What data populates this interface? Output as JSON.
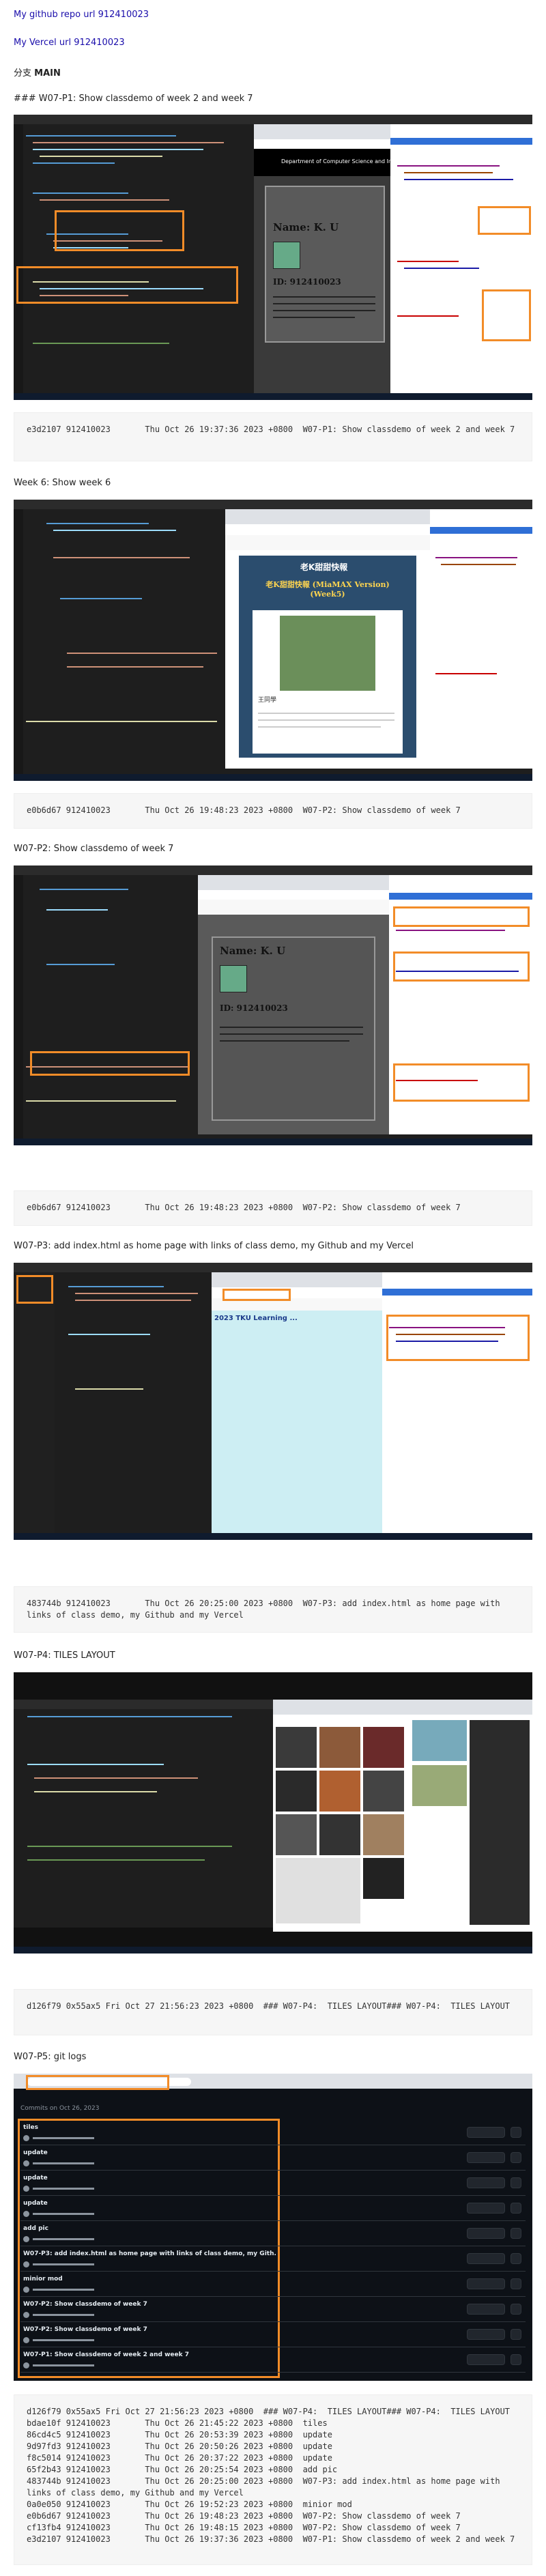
{
  "links": {
    "github_repo": "My github repo url 912410023",
    "vercel": "My Vercel url 912410023"
  },
  "branch": {
    "prefix": "分支",
    "name": "MAIN"
  },
  "sections": [
    {
      "title": "### W07-P1: Show classdemo of week 2 and week 7",
      "commit": "e3d2107 912410023       Thu Oct 26 19:37:36 2023 +0800  W07-P1: Show classdemo of week 2 and week 7",
      "screenshot": {
        "site_header": "Department of Computer Science and Information Engineering",
        "name_label": "Name: K. U",
        "id_label": "ID: 912410023"
      }
    },
    {
      "title": "Week 6: Show week 6",
      "commit": "e0b6d67 912410023       Thu Oct 26 19:48:23 2023 +0800  W07-P2: Show classdemo of week 7",
      "screenshot": {
        "title_cn": "老K甜甜快報",
        "subtitle": "老K甜甜快報 (MiaMAX Version) (Week5)",
        "author": "王同學"
      }
    },
    {
      "title": "W07-P2: Show classdemo of week 7",
      "commit": "e0b6d67 912410023       Thu Oct 26 19:48:23 2023 +0800  W07-P2: Show classdemo of week 7",
      "screenshot": {
        "name_label": "Name: K. U",
        "id_label": "ID: 912410023"
      }
    },
    {
      "title": "W07-P3: add index.html as home page with links of class demo, my Github and my Vercel",
      "commit": "483744b 912410023       Thu Oct 26 20:25:00 2023 +0800  W07-P3: add index.html as home page with links of class demo, my Github and my Vercel",
      "screenshot": {
        "page_heading": "2023 TKU Learning ..."
      }
    },
    {
      "title": "W07-P4: TILES LAYOUT",
      "commit": "d126f79 0x55ax5 Fri Oct 27 21:56:23 2023 +0800  ### W07-P4:  TILES LAYOUT### W07-P4:  TILES LAYOUT",
      "screenshot": {}
    },
    {
      "title": "W07-P5: git logs",
      "commit": "d126f79 0x55ax5 Fri Oct 27 21:56:23 2023 +0800  ### W07-P4:  TILES LAYOUT### W07-P4:  TILES LAYOUT\nbdae10f 912410023       Thu Oct 26 21:45:22 2023 +0800  tiles\n86cd4c5 912410023       Thu Oct 26 20:53:39 2023 +0800  update\n9d97fd3 912410023       Thu Oct 26 20:50:26 2023 +0800  update\nf8c5014 912410023       Thu Oct 26 20:37:22 2023 +0800  update\n65f2b43 912410023       Thu Oct 26 20:25:54 2023 +0800  add pic\n483744b 912410023       Thu Oct 26 20:25:00 2023 +0800  W07-P3: add index.html as home page with links of class demo, my Github and my Vercel\n0a0e050 912410023       Thu Oct 26 19:52:23 2023 +0800  minior mod\ne0b6d67 912410023       Thu Oct 26 19:48:23 2023 +0800  W07-P2: Show classdemo of week 7\ncf13fb4 912410023       Thu Oct 26 19:48:15 2023 +0800  W07-P2: Show classdemo of week 7\ne3d2107 912410023       Thu Oct 26 19:37:36 2023 +0800  W07-P1: Show classdemo of week 2 and week 7",
      "screenshot": {
        "commits_header": "Commits on Oct 26, 2023",
        "commit_items": [
          "tiles",
          "update",
          "update",
          "update",
          "add pic",
          "W07-P3: add index.html as home page with links of class demo, my Gith...",
          "minior mod",
          "W07-P2: Show classdemo of week 7",
          "W07-P2: Show classdemo of week 7",
          "W07-P1: Show classdemo of week 2 and week 7"
        ]
      }
    }
  ],
  "colors": {
    "highlight": "#f28c28",
    "link": "#1a0dab",
    "editor_bg": "#1e1e1e",
    "github_bg": "#0d1117"
  }
}
